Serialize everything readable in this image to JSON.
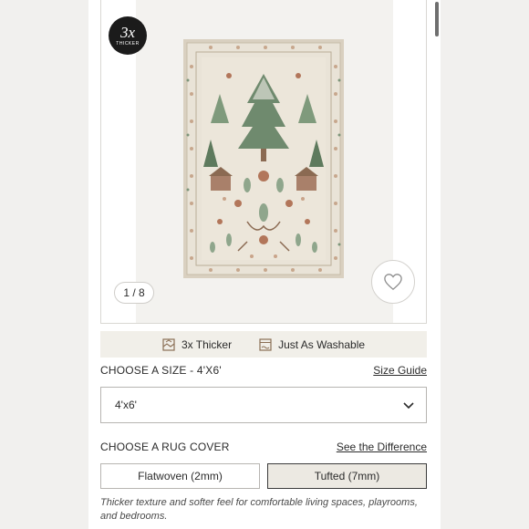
{
  "gallery": {
    "badge_big": "3x",
    "badge_small": "THICKER",
    "counter": "1 / 8"
  },
  "features": [
    {
      "icon": "thicker-icon",
      "label": "3x Thicker"
    },
    {
      "icon": "washable-icon",
      "label": "Just As Washable"
    }
  ],
  "size": {
    "label": "CHOOSE A SIZE - 4'X6'",
    "guide_link": "Size Guide",
    "selected": "4'x6'"
  },
  "cover": {
    "label": "CHOOSE A RUG COVER",
    "difference_link": "See the Difference",
    "options": [
      "Flatwoven (2mm)",
      "Tufted (7mm)"
    ],
    "selected_index": 1,
    "description": "Thicker texture and softer feel for comfortable living spaces, playrooms, and bedrooms."
  },
  "colors": {
    "rug_base": "#e7e0d3",
    "rug_border": "#d9d0c0",
    "green": "#6f8a6e",
    "rust": "#b2765a",
    "selected_bg": "#ece9e2"
  }
}
